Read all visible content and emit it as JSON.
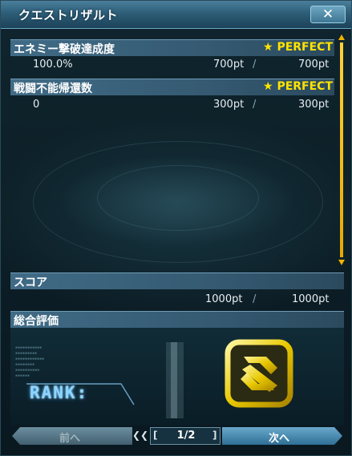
{
  "window": {
    "title": "クエストリザルト",
    "close_label": "✕"
  },
  "objectives": [
    {
      "name": "エネミー撃破達成度",
      "grade": "PERFECT",
      "value": "100.0%",
      "earned": "700pt",
      "max": "700pt"
    },
    {
      "name": "戦闘不能帰還数",
      "grade": "PERFECT",
      "value": "0",
      "earned": "300pt",
      "max": "300pt"
    }
  ],
  "score": {
    "label": "スコア",
    "earned": "1000pt",
    "max": "1000pt"
  },
  "evaluation": {
    "label": "総合評価",
    "rank_label": "RANK:",
    "rank": "S"
  },
  "pager": {
    "prev_label": "前へ",
    "next_label": "次へ",
    "page": "1/2"
  },
  "icons": {
    "star": "star-icon",
    "close": "close-icon",
    "scroll": "scroll-arrow-icons"
  },
  "colors": {
    "grade": "#ffe300",
    "title_bar": "#2e5e78",
    "rank_glow": "#8fd4ff"
  }
}
